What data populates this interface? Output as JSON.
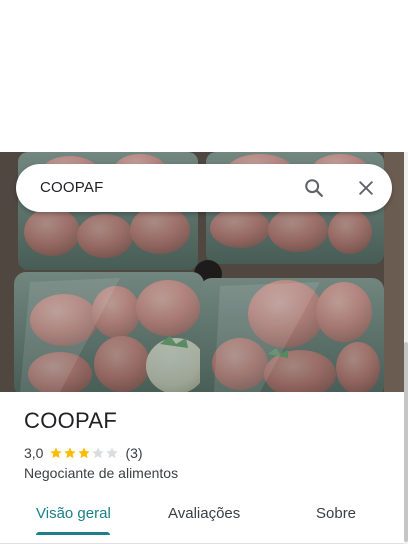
{
  "search": {
    "query": "COOPAF"
  },
  "place": {
    "name": "COOPAF",
    "rating": "3,0",
    "stars": 3,
    "stars_max": 5,
    "review_count": "(3)",
    "category": "Negociante de alimentos"
  },
  "tabs": [
    {
      "label": "Visão geral",
      "active": true
    },
    {
      "label": "Avaliações",
      "active": false
    },
    {
      "label": "Sobre",
      "active": false
    }
  ],
  "colors": {
    "accent": "#1a7f86",
    "star_filled": "#fbbc04",
    "star_empty": "#dadce0",
    "text": "#202124"
  }
}
